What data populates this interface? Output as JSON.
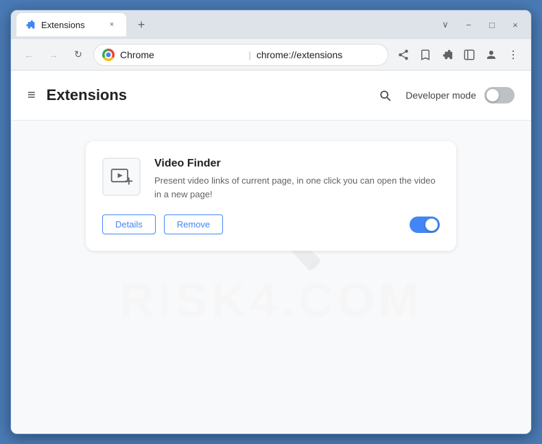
{
  "browser": {
    "tab": {
      "title": "Extensions",
      "close_btn": "×"
    },
    "new_tab_btn": "+",
    "window_controls": {
      "minimize": "−",
      "maximize": "□",
      "close": "×",
      "chevron": "∨"
    },
    "nav": {
      "back": "←",
      "forward": "→",
      "reload": "↻",
      "chrome_label": "Chrome",
      "address": "chrome://extensions",
      "separator": "|"
    }
  },
  "page": {
    "header": {
      "menu_icon": "≡",
      "title": "Extensions",
      "developer_mode_label": "Developer mode"
    },
    "extension": {
      "name": "Video Finder",
      "description": "Present video links of current page, in one click you can open the video in a new page!",
      "details_btn": "Details",
      "remove_btn": "Remove",
      "enabled": true
    }
  },
  "watermark": {
    "text": "RISK4.COM"
  }
}
